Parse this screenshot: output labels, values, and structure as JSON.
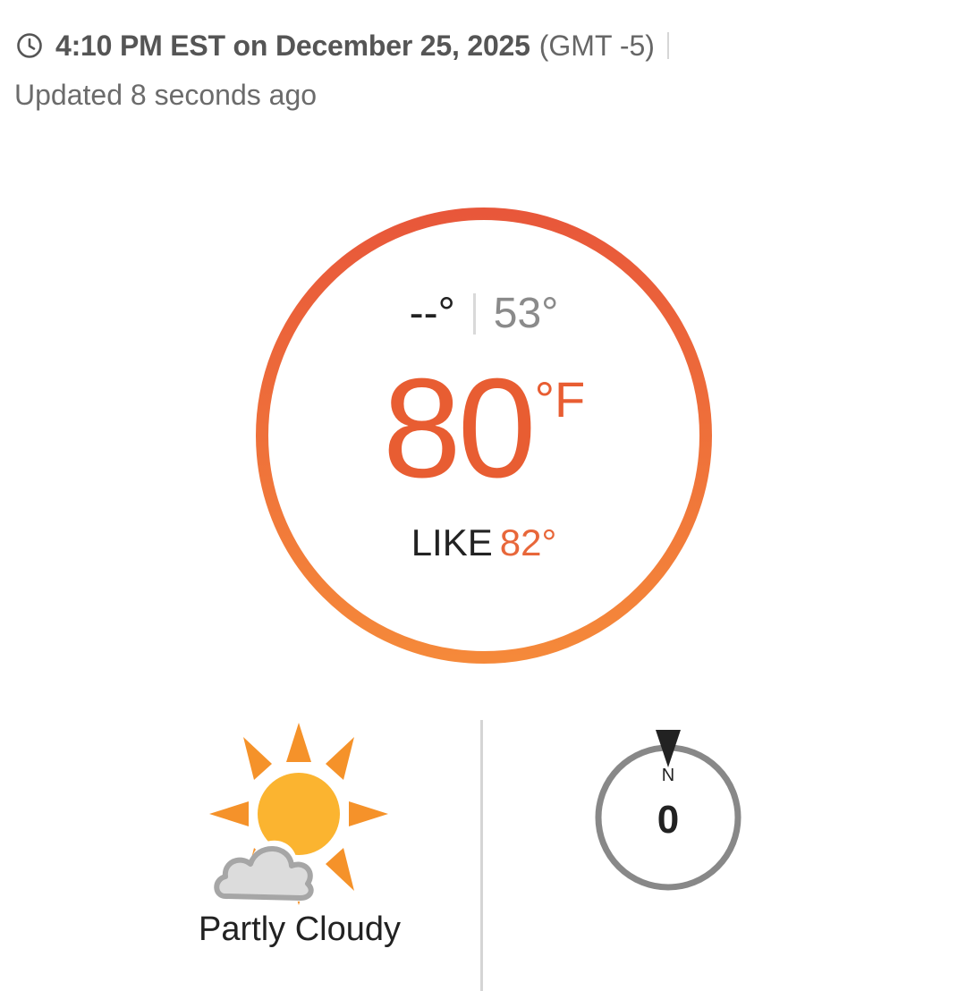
{
  "header": {
    "time_text": "4:10 PM EST on December 25, 2025",
    "timezone_text": "(GMT -5)",
    "updated_text": "Updated 8 seconds ago",
    "clock_icon": "clock-icon"
  },
  "current": {
    "high": "--°",
    "low": "53°",
    "temperature": "80",
    "unit": "°F",
    "feels_like_label": "LIKE",
    "feels_like_value": "82°",
    "ring_color_top": "#e8573a",
    "ring_color_bottom": "#f5893a"
  },
  "condition": {
    "label": "Partly Cloudy",
    "icon": "partly-cloudy-icon"
  },
  "wind": {
    "direction_label": "N",
    "speed": "0",
    "icon": "compass-icon"
  }
}
